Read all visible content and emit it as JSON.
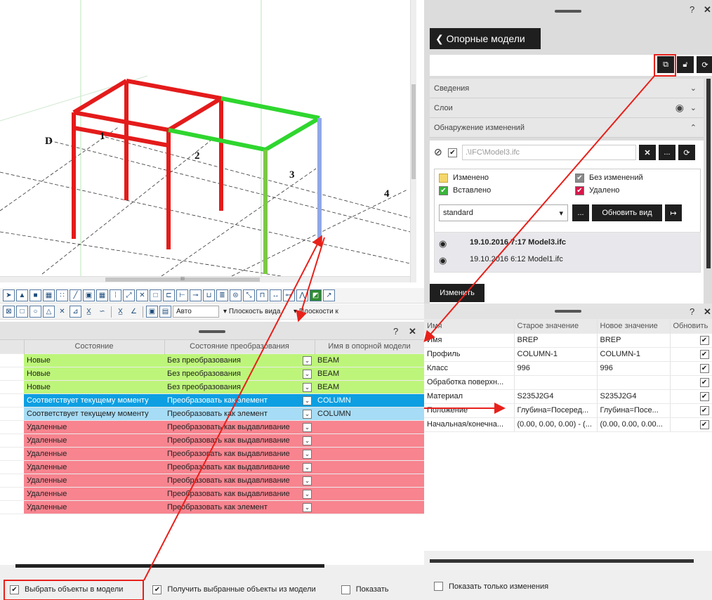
{
  "viewport": {
    "axis_labels": [
      "D",
      "1",
      "2",
      "3",
      "4"
    ],
    "scroll_label": "III"
  },
  "toolbar2": {
    "combo_auto": "Авто",
    "combo_view_plane": "Плоскость вида",
    "combo_planes": "Плоскости к"
  },
  "status_table": {
    "headers": [
      "Состояние",
      "Состояние преобразования",
      "Имя в опорной модели"
    ],
    "rows": [
      {
        "state": "Новые",
        "conversion": "Без преобразования",
        "name": "BEAM",
        "type": "new"
      },
      {
        "state": "Новые",
        "conversion": "Без преобразования",
        "name": "BEAM",
        "type": "new"
      },
      {
        "state": "Новые",
        "conversion": "Без преобразования",
        "name": "BEAM",
        "type": "new"
      },
      {
        "state": "Соответствует текущему моменту",
        "conversion": "Преобразовать как элемент",
        "name": "COLUMN",
        "type": "selected"
      },
      {
        "state": "Соответствует текущему моменту",
        "conversion": "Преобразовать как элемент",
        "name": "COLUMN",
        "type": "current"
      },
      {
        "state": "Удаленные",
        "conversion": "Преобразовать как выдавливание",
        "name": "",
        "type": "deleted"
      },
      {
        "state": "Удаленные",
        "conversion": "Преобразовать как выдавливание",
        "name": "",
        "type": "deleted"
      },
      {
        "state": "Удаленные",
        "conversion": "Преобразовать как выдавливание",
        "name": "",
        "type": "deleted"
      },
      {
        "state": "Удаленные",
        "conversion": "Преобразовать как выдавливание",
        "name": "",
        "type": "deleted"
      },
      {
        "state": "Удаленные",
        "conversion": "Преобразовать как выдавливание",
        "name": "",
        "type": "deleted"
      },
      {
        "state": "Удаленные",
        "conversion": "Преобразовать как выдавливание",
        "name": "",
        "type": "deleted"
      },
      {
        "state": "Удаленные",
        "conversion": "Преобразовать как элемент",
        "name": "",
        "type": "deleted"
      }
    ],
    "footer": {
      "select_in_model": "Выбрать объекты в модели",
      "get_selected": "Получить выбранные объекты из модели",
      "show": "Показать"
    },
    "colors": {
      "new": "#bdf57a",
      "selected": "#0d9fe2",
      "current": "#a6dcf5",
      "deleted": "#f7848f"
    }
  },
  "ref_panel": {
    "title": "Опорные модели",
    "sections": {
      "info": "Сведения",
      "layers": "Слои",
      "change_detection": "Обнаружение изменений"
    },
    "file_path": ".\\IFC\\Model3.ifc",
    "legend": {
      "changed": "Изменено",
      "unchanged": "Без изменений",
      "inserted": "Вставлено",
      "deleted": "Удалено"
    },
    "legend_colors": {
      "changed": "#f4d76a",
      "unchanged": "#8a8a8a",
      "inserted": "#3cb43c",
      "deleted": "#d6184a"
    },
    "settings_value": "standard",
    "more_label": "...",
    "update_view": "Обновить вид",
    "versions": [
      "19.10.2016 7:17 Model3.ifc",
      "19.10.2016 6:12 Model1.ifc"
    ],
    "edit_button": "Изменить"
  },
  "props_panel": {
    "headers": [
      "Имя",
      "Старое значение",
      "Новое значение",
      "Обновить"
    ],
    "rows": [
      {
        "name": "Имя",
        "old": "BREP",
        "new": "BREP"
      },
      {
        "name": "Профиль",
        "old": "COLUMN-1",
        "new": "COLUMN-1"
      },
      {
        "name": "Класс",
        "old": "996",
        "new": "996"
      },
      {
        "name": "Обработка поверхн...",
        "old": "",
        "new": ""
      },
      {
        "name": "Материал",
        "old": "S235J2G4",
        "new": "S235J2G4"
      },
      {
        "name": "Положение",
        "old": "Глубина=Посеред...",
        "new": "Глубина=Посе..."
      },
      {
        "name": "Начальная/конечна...",
        "old": "(0.00, 0.00, 0.00) - (...",
        "new": "(0.00, 0.00, 0.00..."
      }
    ],
    "show_only_changes": "Показать только изменения"
  },
  "annotation_color": "#e8201a"
}
